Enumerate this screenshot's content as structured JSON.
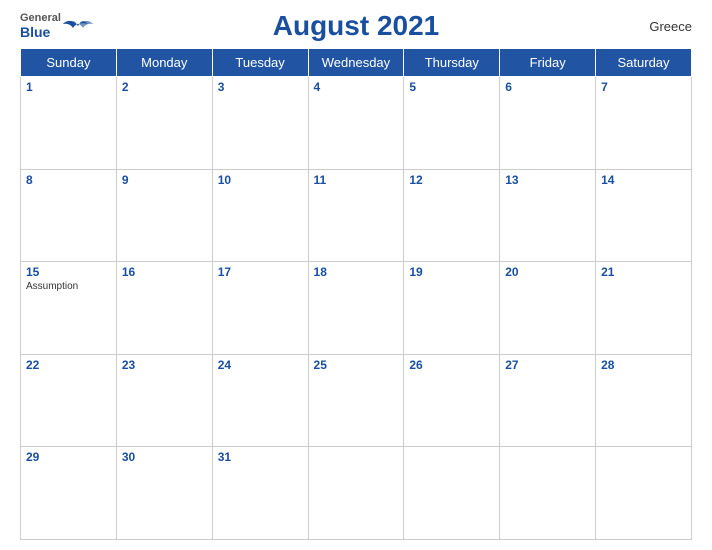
{
  "header": {
    "logo_general": "General",
    "logo_blue": "Blue",
    "title": "August 2021",
    "country": "Greece"
  },
  "weekdays": [
    "Sunday",
    "Monday",
    "Tuesday",
    "Wednesday",
    "Thursday",
    "Friday",
    "Saturday"
  ],
  "weeks": [
    [
      {
        "day": 1,
        "events": []
      },
      {
        "day": 2,
        "events": []
      },
      {
        "day": 3,
        "events": []
      },
      {
        "day": 4,
        "events": []
      },
      {
        "day": 5,
        "events": []
      },
      {
        "day": 6,
        "events": []
      },
      {
        "day": 7,
        "events": []
      }
    ],
    [
      {
        "day": 8,
        "events": []
      },
      {
        "day": 9,
        "events": []
      },
      {
        "day": 10,
        "events": []
      },
      {
        "day": 11,
        "events": []
      },
      {
        "day": 12,
        "events": []
      },
      {
        "day": 13,
        "events": []
      },
      {
        "day": 14,
        "events": []
      }
    ],
    [
      {
        "day": 15,
        "events": [
          "Assumption"
        ]
      },
      {
        "day": 16,
        "events": []
      },
      {
        "day": 17,
        "events": []
      },
      {
        "day": 18,
        "events": []
      },
      {
        "day": 19,
        "events": []
      },
      {
        "day": 20,
        "events": []
      },
      {
        "day": 21,
        "events": []
      }
    ],
    [
      {
        "day": 22,
        "events": []
      },
      {
        "day": 23,
        "events": []
      },
      {
        "day": 24,
        "events": []
      },
      {
        "day": 25,
        "events": []
      },
      {
        "day": 26,
        "events": []
      },
      {
        "day": 27,
        "events": []
      },
      {
        "day": 28,
        "events": []
      }
    ],
    [
      {
        "day": 29,
        "events": []
      },
      {
        "day": 30,
        "events": []
      },
      {
        "day": 31,
        "events": []
      },
      null,
      null,
      null,
      null
    ]
  ]
}
